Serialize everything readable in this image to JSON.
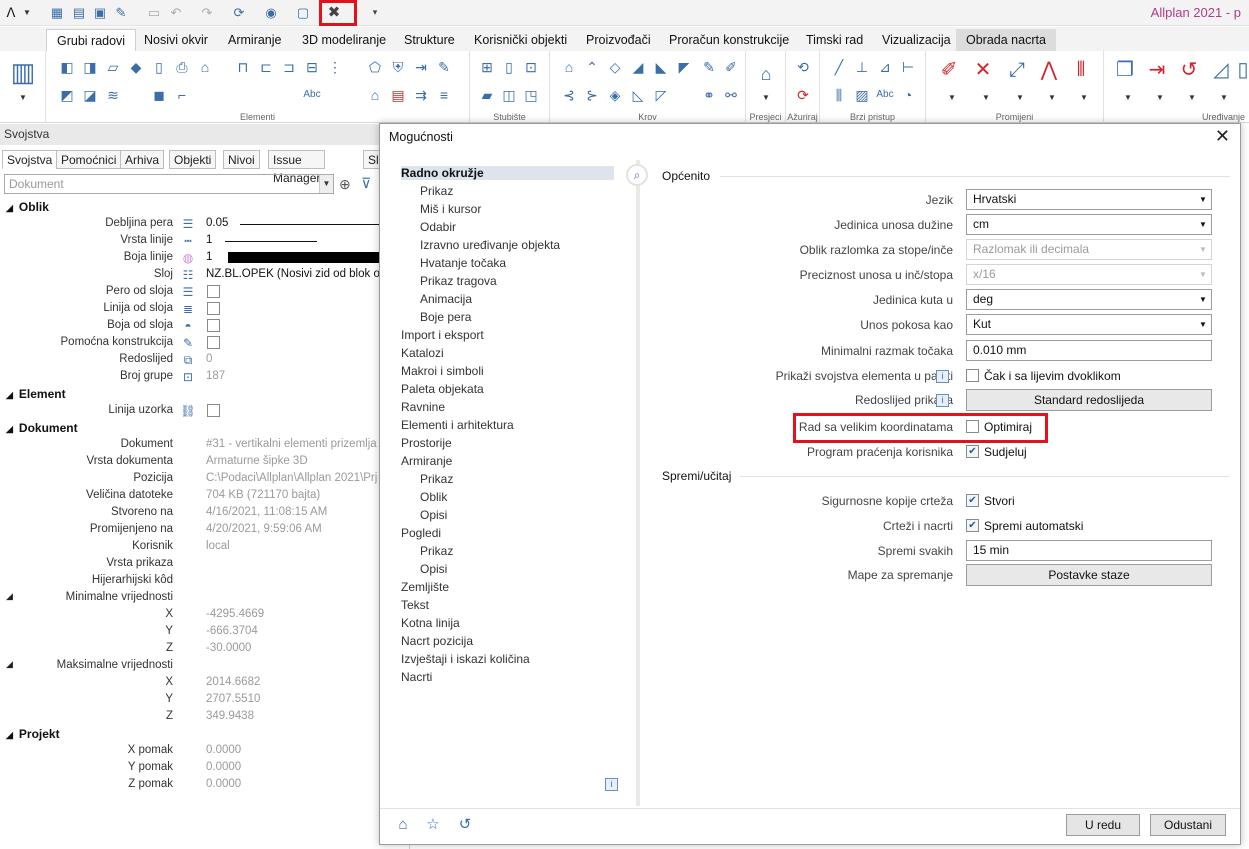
{
  "app": {
    "title": "Allplan 2021 - p",
    "logo": "ᐱ"
  },
  "ribbon": {
    "tabs": [
      "Grubi radovi",
      "Nosivi okvir",
      "Armiranje",
      "3D modeliranje",
      "Strukture",
      "Korisnički objekti",
      "Proizvođači",
      "Proračun konstrukcije",
      "Timski rad",
      "Vizualizacija",
      "Obrada nacrta"
    ],
    "active_tab": "Grubi radovi",
    "groups": [
      "Elementi",
      "Stubište",
      "Krov",
      "Presjeci",
      "Ažuriraj",
      "Brzi pristup",
      "Promijeni",
      "Uređivanje"
    ],
    "highlighted_button": "options-tool-icon"
  },
  "palette": {
    "title": "Svojstva",
    "tabs": [
      "Svojstva",
      "Pomoćnici",
      "Arhiva",
      "Objekti",
      "Nivoi",
      "Issue Manager",
      "Sl"
    ],
    "filter_placeholder": "Dokument",
    "sections": {
      "oblik": "Oblik",
      "element": "Element",
      "dokument": "Dokument",
      "projekt": "Projekt"
    },
    "oblik": {
      "pen_label": "Debljina pera",
      "pen_value": "0.05",
      "line_label": "Vrsta linije",
      "line_value": "1",
      "color_label": "Boja linije",
      "color_value": "1",
      "layer_label": "Sloj",
      "layer_value": "NZ.BL.OPEK (Nosivi zid od blok op",
      "pen_from_layer": "Pero od sloja",
      "line_from_layer": "Linija od sloja",
      "color_from_layer": "Boja od sloja",
      "aux_construction": "Pomoćna konstrukcija",
      "order_label": "Redoslijed",
      "order_value": "0",
      "group_label": "Broj grupe",
      "group_value": "187"
    },
    "element": {
      "pattern_line": "Linija uzorka"
    },
    "dokument": {
      "doc_label": "Dokument",
      "doc_value": "#31 - vertikalni elementi prizemlja",
      "type_label": "Vrsta dokumenta",
      "type_value": "Armaturne šipke 3D",
      "pos_label": "Pozicija",
      "pos_value": "C:\\Podaci\\Allplan\\Allplan 2021\\Prj",
      "size_label": "Veličina datoteke",
      "size_value": "704 KB (721170 bajta)",
      "created_label": "Stvoreno na",
      "created_value": "4/16/2021, 11:08:15 AM",
      "modified_label": "Promijenjeno na",
      "modified_value": "4/20/2021, 9:59:06 AM",
      "user_label": "Korisnik",
      "user_value": "local",
      "display_label": "Vrsta prikaza",
      "hier_label": "Hijerarhijski kôd",
      "min_label": "Minimalne vrijednosti",
      "min_x": "-4295.4669",
      "min_y": "-666.3704",
      "min_z": "-30.0000",
      "max_label": "Maksimalne vrijednosti",
      "max_x": "2014.6682",
      "max_y": "2707.5510",
      "max_z": "349.9438",
      "x": "X",
      "y": "Y",
      "z": "Z"
    },
    "projekt": {
      "xoff_label": "X pomak",
      "xoff_value": "0.0000",
      "yoff_label": "Y pomak",
      "yoff_value": "0.0000",
      "zoff_label": "Z pomak",
      "zoff_value": "0.0000"
    }
  },
  "dialog": {
    "title": "Mogućnosti",
    "tree": [
      {
        "label": "Radno okružje",
        "level": 0,
        "selected": true
      },
      {
        "label": "Prikaz",
        "level": 1
      },
      {
        "label": "Miš i kursor",
        "level": 1
      },
      {
        "label": "Odabir",
        "level": 1
      },
      {
        "label": "Izravno uređivanje objekta",
        "level": 1
      },
      {
        "label": "Hvatanje točaka",
        "level": 1
      },
      {
        "label": "Prikaz tragova",
        "level": 1
      },
      {
        "label": "Animacija",
        "level": 1
      },
      {
        "label": "Boje pera",
        "level": 1
      },
      {
        "label": "Import i eksport",
        "level": 0
      },
      {
        "label": "Katalozi",
        "level": 0
      },
      {
        "label": "Makroi i simboli",
        "level": 0
      },
      {
        "label": "Paleta objekata",
        "level": 0
      },
      {
        "label": "Ravnine",
        "level": 0
      },
      {
        "label": "Elementi i arhitektura",
        "level": 0
      },
      {
        "label": "Prostorije",
        "level": 0
      },
      {
        "label": "Armiranje",
        "level": 0
      },
      {
        "label": "Prikaz",
        "level": 1
      },
      {
        "label": "Oblik",
        "level": 1
      },
      {
        "label": "Opisi",
        "level": 1
      },
      {
        "label": "Pogledi",
        "level": 0
      },
      {
        "label": "Prikaz",
        "level": 1
      },
      {
        "label": "Opisi",
        "level": 1
      },
      {
        "label": "Zemljište",
        "level": 0
      },
      {
        "label": "Tekst",
        "level": 0
      },
      {
        "label": "Kotna linija",
        "level": 0
      },
      {
        "label": "Nacrt pozicija",
        "level": 0
      },
      {
        "label": "Izvještaji i iskazi količina",
        "level": 0
      },
      {
        "label": "Nacrti",
        "level": 0
      }
    ],
    "general": {
      "header": "Općenito",
      "language_label": "Jezik",
      "language_value": "Hrvatski",
      "length_unit_label": "Jedinica unosa dužine",
      "length_unit_value": "cm",
      "fraction_label": "Oblik razlomka za stope/inče",
      "fraction_value": "Razlomak ili decimala",
      "precision_label": "Preciznost unosa u inč/stopa",
      "precision_value": "x/16",
      "angle_unit_label": "Jedinica kuta u",
      "angle_unit_value": "deg",
      "slope_label": "Unos pokosa kao",
      "slope_value": "Kut",
      "min_dist_label": "Minimalni razmak točaka",
      "min_dist_value": "0.010 mm",
      "show_props_label": "Prikaži  svojstva elementa u paleti",
      "show_props_check": "Čak i sa lijevim dvoklikom",
      "display_order_label": "Redoslijed prikaza",
      "display_order_button": "Standard redoslijeda",
      "large_coords_label": "Rad sa velikim koordinatama",
      "large_coords_check": "Optimiraj",
      "tracking_label": "Program praćenja korisnika",
      "tracking_check": "Sudjeluj"
    },
    "save": {
      "header": "Spremi/učitaj",
      "backup_label": "Sigurnosne kopije crteža",
      "backup_check": "Stvori",
      "drawings_label": "Crteži i nacrti",
      "drawings_check": "Spremi automatski",
      "interval_label": "Spremi svakih",
      "interval_value": "15 min",
      "folders_label": "Mape za spremanje",
      "folders_button": "Postavke staze"
    },
    "buttons": {
      "ok": "U redu",
      "cancel": "Odustani"
    },
    "checks": {
      "show_props": false,
      "large_coords": false,
      "tracking": true,
      "backup": true,
      "drawings": true
    }
  }
}
